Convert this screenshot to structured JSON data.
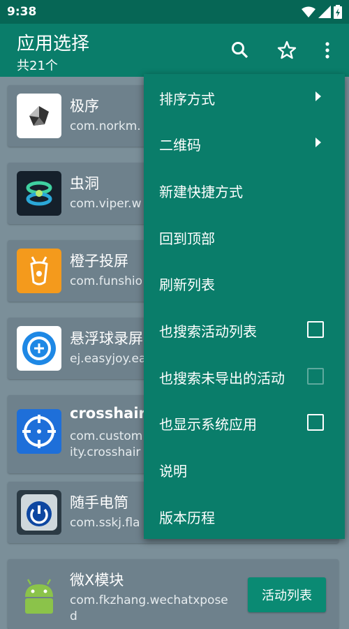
{
  "status": {
    "time": "9:38"
  },
  "appbar": {
    "title": "应用选择",
    "subtitle": "共21个"
  },
  "apps": [
    {
      "name": "极序",
      "package": "com.norkm."
    },
    {
      "name": "虫洞",
      "package": "com.viper.w"
    },
    {
      "name": "橙子投屏",
      "package": "com.funshio"
    },
    {
      "name": "悬浮球录屏",
      "package": "ej.easyjoy.ea"
    },
    {
      "name": "crosshair",
      "package": "com.custom\nity.crosshair"
    },
    {
      "name": "随手电筒",
      "package": "com.sskj.fla"
    },
    {
      "name": "微X模块",
      "package": "com.fkzhang.wechatxpose\nd",
      "action_label": "活动列表"
    }
  ],
  "menu": {
    "items": [
      {
        "label": "排序方式",
        "submenu": true
      },
      {
        "label": "二维码",
        "submenu": true
      },
      {
        "label": "新建快捷方式"
      },
      {
        "label": "回到顶部"
      },
      {
        "label": "刷新列表"
      },
      {
        "label": "也搜索活动列表",
        "checkbox": false
      },
      {
        "label": "也搜索未导出的活动",
        "checkbox": false,
        "disabled": true
      },
      {
        "label": "也显示系统应用",
        "checkbox": false
      },
      {
        "label": "说明"
      },
      {
        "label": "版本历程"
      }
    ]
  },
  "colors": {
    "primary": "#0a7d6a",
    "statusbar": "#066655",
    "card": "#6e818c",
    "background": "#7b8f99"
  }
}
